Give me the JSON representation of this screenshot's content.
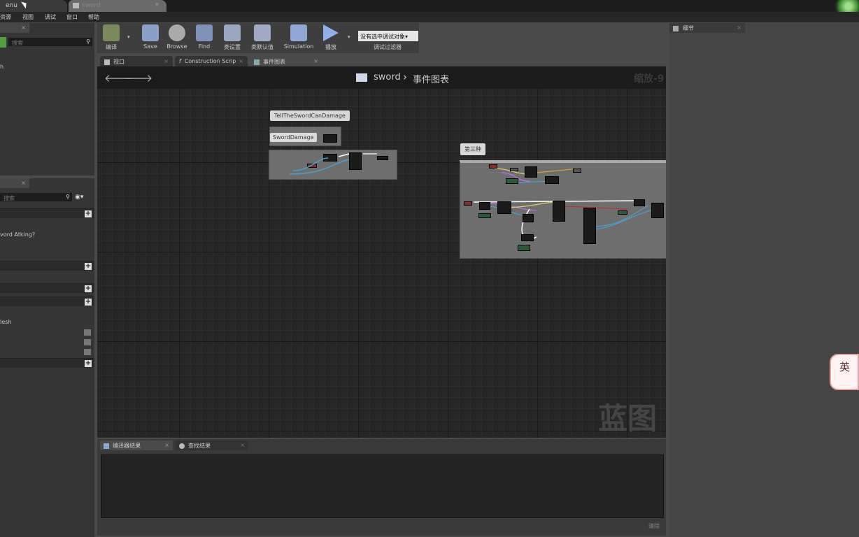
{
  "window": {
    "tabs": [
      {
        "label": "enu"
      },
      {
        "label": "sword"
      }
    ]
  },
  "menubar": {
    "items": [
      "资源",
      "视图",
      "调试",
      "窗口",
      "帮助"
    ]
  },
  "left_panel": {
    "top": {
      "search_placeholder": "搜索",
      "item": "h"
    },
    "mid": {
      "search_placeholder": "搜索",
      "var_label": "vord Atking?",
      "comp_label": "lesh"
    }
  },
  "toolbar": {
    "compile": "编译",
    "save": "Save",
    "browse": "Browse",
    "find": "Find",
    "class_settings": "类设置",
    "class_defaults": "类默认值",
    "simulation": "Simulation",
    "play": "播放",
    "debug_target": "没有选中调试对象▾",
    "debug_filter": "调试过滤器"
  },
  "doc_tabs": [
    "视口",
    "Construction Scrip",
    "事件图表"
  ],
  "graph": {
    "breadcrumb_root": "sword",
    "breadcrumb_sep": "›",
    "breadcrumb_child": "事件图表",
    "zoom": "缩放-9",
    "watermark": "蓝图",
    "comment1": "TellTheSwordCanDamage",
    "comment2": "SwordDamage",
    "comment3": "第三种"
  },
  "bottom_tabs": [
    "编译器结果",
    "查找结果"
  ],
  "bottom": {
    "clear": "清除"
  },
  "details": {
    "tab": "细节"
  },
  "overlay": {
    "badge": "英"
  },
  "colors": {
    "accent_green": "#5fbf4a",
    "graph_bg": "#262626",
    "panel_bg": "#353535"
  }
}
